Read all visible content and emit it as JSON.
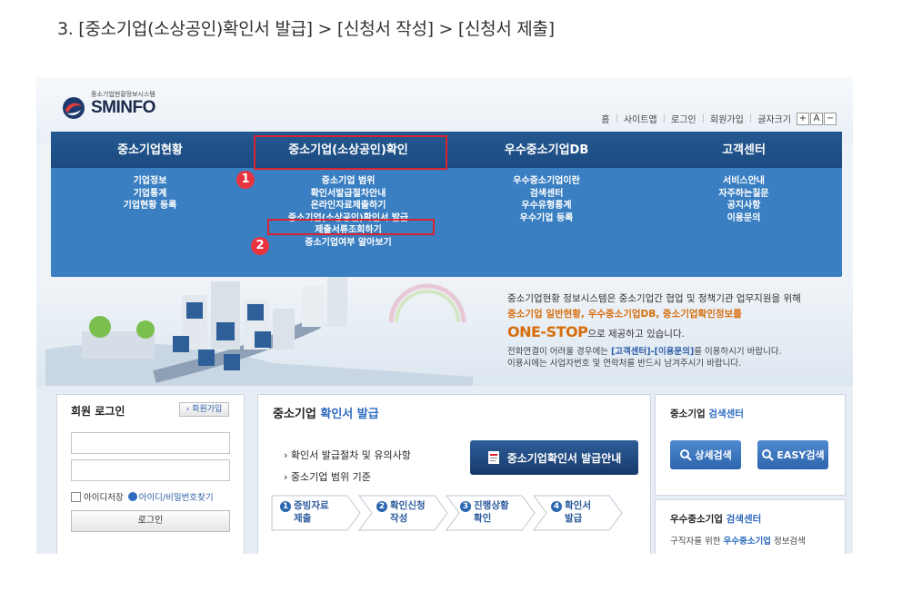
{
  "heading": "3. [중소기업(소상공인)확인서 발급] > [신청서 작성] > [신청서 제출]",
  "site": {
    "logo_sub": "중소기업현황정보시스템",
    "logo_name": "SMINFO"
  },
  "util_links": [
    "홈",
    "사이트맵",
    "로그인",
    "회원가입",
    "글자크기"
  ],
  "font_buttons": [
    "+",
    "A",
    "−"
  ],
  "gnb": {
    "menus": [
      "중소기업현황",
      "중소기업(소상공인)확인",
      "우수중소기업DB",
      "고객센터"
    ],
    "col1": [
      "기업정보",
      "기업통계",
      "기업현황 등록"
    ],
    "col2": [
      "중소기업 범위",
      "확인서발급절차안내",
      "온라인자료제출하기",
      "중소기업(소상공인)확인서 발급",
      "제출서류조회하기",
      "중소기업여부 알아보기"
    ],
    "col3": [
      "우수중소기업이란",
      "검색센터",
      "우수유형통계",
      "우수기업 등록"
    ],
    "col4": [
      "서비스안내",
      "자주하는질문",
      "공지사항",
      "이용문의"
    ]
  },
  "badges": [
    "1",
    "2"
  ],
  "banner": {
    "line1": "중소기업현황 정보시스템은 중소기업간 협업 및 정책기관 업무지원을 위해",
    "line2": "중소기업 일반현황, 우수중소기업DB, 중소기업확인정보를",
    "line3_big": "ONE-STOP",
    "line3_rest": "으로 제공하고 있습니다.",
    "line4_a": "전화연결이 어려울 경우에는 ",
    "line4_link": "[고객센터]-[이용문의]",
    "line4_b": "를 이용하시기 바랍니다.",
    "line5": "이용시에는 사업자번호 및 연락처를 반드시 남겨주시기 바랍니다."
  },
  "login": {
    "title": "회원 로그인",
    "join": "› 회원가입",
    "remember": "아이디저장",
    "find": "아이디/비밀번호찾기",
    "button": "로그인"
  },
  "issue": {
    "title_a": "중소기업 ",
    "title_b": "확인서 발급",
    "link1": "› 확인서 발급절차 및 유의사항",
    "link2": "› 중소기업 범위 기준",
    "guide_button": "중소기업확인서 발급안내",
    "steps": [
      {
        "num": "1",
        "l1": "증빙자료",
        "l2": "제출"
      },
      {
        "num": "2",
        "l1": "확인신청",
        "l2": "작성"
      },
      {
        "num": "3",
        "l1": "진행상황",
        "l2": "확인"
      },
      {
        "num": "4",
        "l1": "확인서",
        "l2": "발급"
      }
    ]
  },
  "search": {
    "title_a": "중소기업 ",
    "title_b": "검색센터",
    "detail": "상세검색",
    "easy": "EASY검색",
    "title2_a": "우수중소기업 ",
    "title2_b": "검색센터",
    "sub_a": "구직자를 위한 ",
    "sub_b": "우수중소기업",
    "sub_c": " 정보검색"
  }
}
